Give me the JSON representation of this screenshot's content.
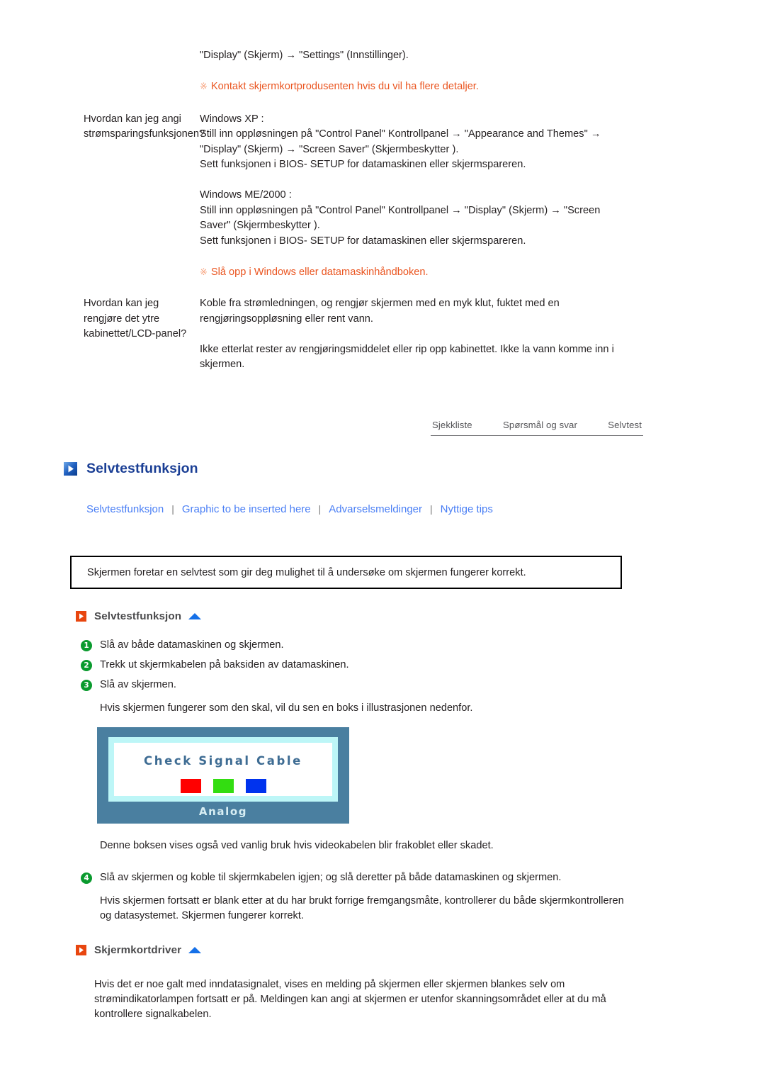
{
  "faq": {
    "intro_line": "\"Display\" (Skjerm) → \"Settings\" (Innstillinger).",
    "intro_note": "Kontakt skjermkortprodusenten hvis du vil ha flere detaljer.",
    "rows": [
      {
        "question": "Hvordan kan jeg angi strømsparingsfunksjonen?",
        "answer_blocks": [
          "Windows XP :",
          "Still inn oppløsningen på \"Control Panel\" Kontrollpanel → \"Appearance and Themes\" → \"Display\" (Skjerm) → \"Screen Saver\" (Skjermbeskytter ).",
          "Sett funksjonen i BIOS- SETUP for datamaskinen eller skjermspareren.",
          "Windows ME/2000 :",
          "Still inn oppløsningen på \"Control Panel\" Kontrollpanel → \"Display\" (Skjerm) → \"Screen Saver\" (Skjermbeskytter ).",
          "Sett funksjonen i BIOS- SETUP for datamaskinen eller skjermspareren."
        ],
        "note": "Slå opp i Windows eller datamaskinhåndboken."
      },
      {
        "question": "Hvordan kan jeg rengjøre det ytre kabinettet/LCD-panel?",
        "answer_blocks": [
          "Koble fra strømledningen, og rengjør skjermen med en myk klut, fuktet med en rengjøringsoppløsning eller rent vann.",
          "Ikke etterlat rester av rengjøringsmiddelet eller rip opp kabinettet. Ikke la vann komme inn i skjermen."
        ],
        "note": ""
      }
    ],
    "note_mark": "※"
  },
  "tabbar": {
    "tabs": [
      {
        "label": "Sjekkliste"
      },
      {
        "label": "Spørsmål og svar"
      },
      {
        "label": "Selvtest"
      }
    ]
  },
  "main_heading": {
    "title": "Selvtestfunksjon",
    "icon": "play-square-icon"
  },
  "breadcrumbs": {
    "separator": "|",
    "links": [
      {
        "label": "Selvtestfunksjon"
      },
      {
        "label": "Graphic to be inserted here"
      },
      {
        "label": "Advarselsmeldinger"
      },
      {
        "label": "Nyttige tips"
      }
    ]
  },
  "callout": {
    "text": "Skjermen foretar en selvtest som gir deg mulighet til å undersøke om skjermen fungerer korrekt."
  },
  "section_selftest": {
    "title": "Selvtestfunksjon",
    "icon": "play-square-icon",
    "collapse_icon": "triangle-up-icon",
    "steps": [
      {
        "num": "1",
        "text": "Slå av både datamaskinen og skjermen."
      },
      {
        "num": "2",
        "text": "Trekk ut skjermkabelen på baksiden av datamaskinen."
      },
      {
        "num": "3",
        "text": "Slå av skjermen."
      }
    ],
    "after_steps_text": "Hvis skjermen fungerer som den skal, vil du sen en boks i illustrasjonen nedenfor.",
    "osd": {
      "title": "Check Signal Cable",
      "label": "Analog",
      "swatches": [
        {
          "name": "red-swatch",
          "color": "#ff0000"
        },
        {
          "name": "green-swatch",
          "color": "#33dd11"
        },
        {
          "name": "blue-swatch",
          "color": "#0033ee"
        }
      ],
      "frame_color": "#4a7fa0",
      "inner_border_color": "#bdf6f7"
    },
    "osd_caption": "Denne boksen vises også ved vanlig bruk hvis videokabelen blir frakoblet eller skadet.",
    "step4": {
      "num": "4",
      "text": "Slå av skjermen og koble til skjermkabelen igjen; og slå deretter på både datamaskinen og skjermen."
    },
    "final_text": "Hvis skjermen fortsatt er blank etter at du har brukt forrige fremgangsmåte, kontrollerer du både skjermkontrolleren og datasystemet. Skjermen fungerer korrekt."
  },
  "section_driver": {
    "title": "Skjermkortdriver",
    "icon": "play-square-icon",
    "collapse_icon": "triangle-up-icon",
    "body": "Hvis det er noe galt med inndatasignalet, vises en melding på skjermen eller skjermen blankes selv om strømindikatorlampen fortsatt er på. Meldingen kan angi at skjermen er utenfor skanningsområdet eller at du må kontrollere signalkabelen."
  },
  "colors": {
    "link_blue": "#4a7ff5",
    "heading_blue": "#1b3f95",
    "note_orange": "#ea5520",
    "step_green": "#0a9a2e",
    "sub_icon_orange": "#e8460f"
  }
}
